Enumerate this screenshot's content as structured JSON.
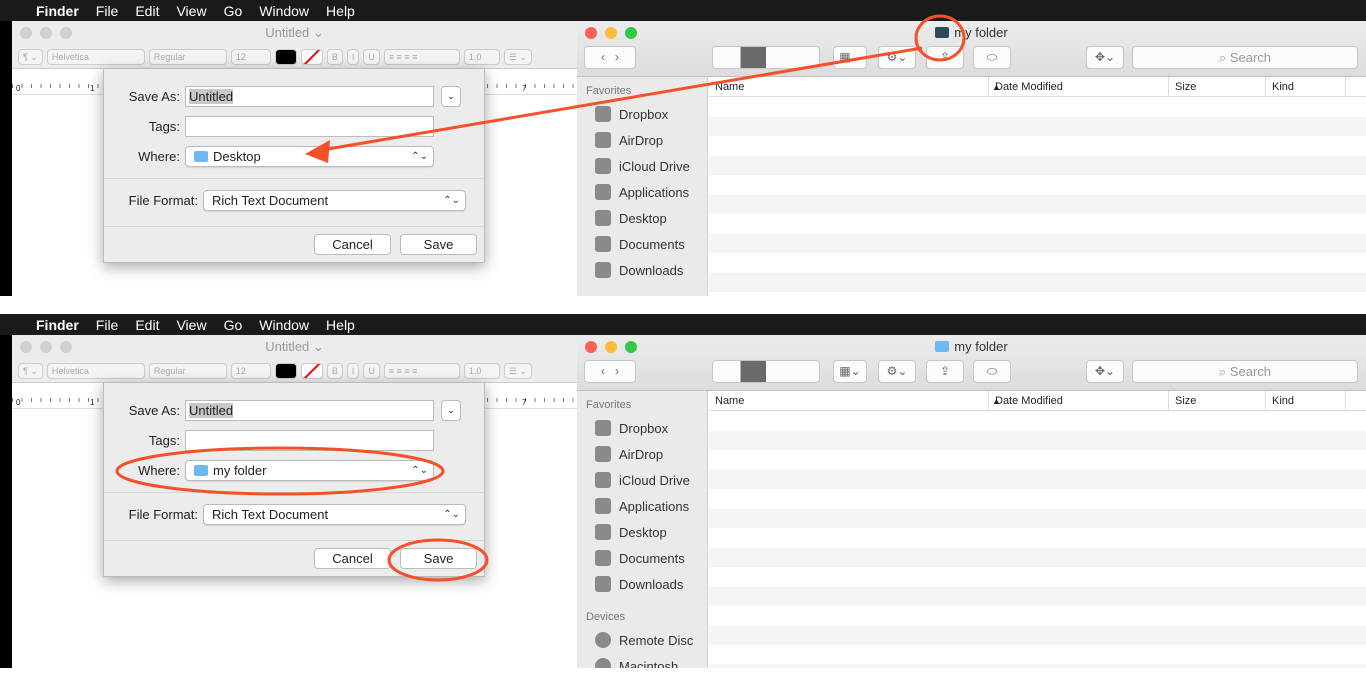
{
  "menubar": {
    "apple": "",
    "items": [
      "Finder",
      "File",
      "Edit",
      "View",
      "Go",
      "Window",
      "Help"
    ]
  },
  "textedit": {
    "title": "Untitled ⌄",
    "toolbar": {
      "paragraph": "¶ ⌄",
      "font": "Helvetica",
      "style": "Regular",
      "size": "12",
      "bold": "B",
      "italic": "I",
      "underline": "U",
      "spacing": "1.0",
      "list": "☰ ⌄"
    },
    "ruler": [
      "0",
      "1",
      "7"
    ]
  },
  "dialog": {
    "save_as_label": "Save As:",
    "save_as_value": "Untitled",
    "tags_label": "Tags:",
    "tags_value": "",
    "where_label": "Where:",
    "file_format_label": "File Format:",
    "file_format_value": "Rich Text Document",
    "cancel": "Cancel",
    "save": "Save"
  },
  "top": {
    "where_value": "Desktop"
  },
  "bottom": {
    "where_value": "my folder"
  },
  "finder": {
    "title": "my folder",
    "search_placeholder": "Search",
    "columns": [
      "Name",
      "Date Modified",
      "Size",
      "Kind"
    ],
    "favorites_label": "Favorites",
    "favorites": [
      {
        "label": "Dropbox",
        "icon": "dropbox-icon"
      },
      {
        "label": "AirDrop",
        "icon": "airdrop-icon"
      },
      {
        "label": "iCloud Drive",
        "icon": "cloud-icon"
      },
      {
        "label": "Applications",
        "icon": "applications-icon"
      },
      {
        "label": "Desktop",
        "icon": "desktop-icon"
      },
      {
        "label": "Documents",
        "icon": "documents-icon"
      },
      {
        "label": "Downloads",
        "icon": "downloads-icon"
      }
    ],
    "devices_label": "Devices",
    "devices": [
      {
        "label": "Remote Disc",
        "icon": "disc-icon"
      },
      {
        "label": "Macintosh ...",
        "icon": "hard-drive-icon"
      }
    ]
  },
  "annotation_color": "#f4502a"
}
